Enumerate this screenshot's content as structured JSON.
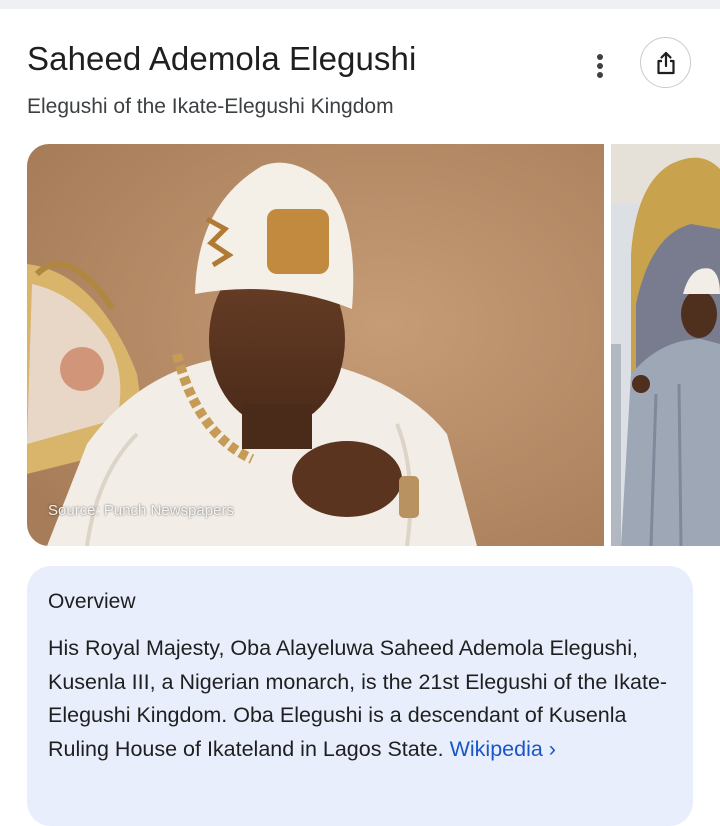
{
  "knowledge_panel": {
    "title": "Saheed Ademola Elegushi",
    "subtitle": "Elegushi of the Ikate-Elegushi Kingdom",
    "actions": {
      "more_icon": "more-vert-icon",
      "share_icon": "share-icon"
    },
    "images": {
      "main_source": "Source: Punch Newspapers",
      "main_alt": "portrait-photo",
      "second_alt": "throne-photo"
    },
    "overview": {
      "heading": "Overview",
      "text": "His Royal Majesty, Oba Alayeluwa Saheed Ademola Elegushi, Kusenla III, a Nigerian monarch, is the 21st Elegushi of the Ikate-Elegushi Kingdom. Oba Elegushi is a descendant of Kusenla Ruling House of Ikateland in Lagos State.",
      "link_label": "Wikipedia",
      "link_chevron": "›"
    }
  },
  "colors": {
    "card_background": "#e8eefb",
    "link": "#1a56c7",
    "photo_backdrop": "#b68a65"
  }
}
